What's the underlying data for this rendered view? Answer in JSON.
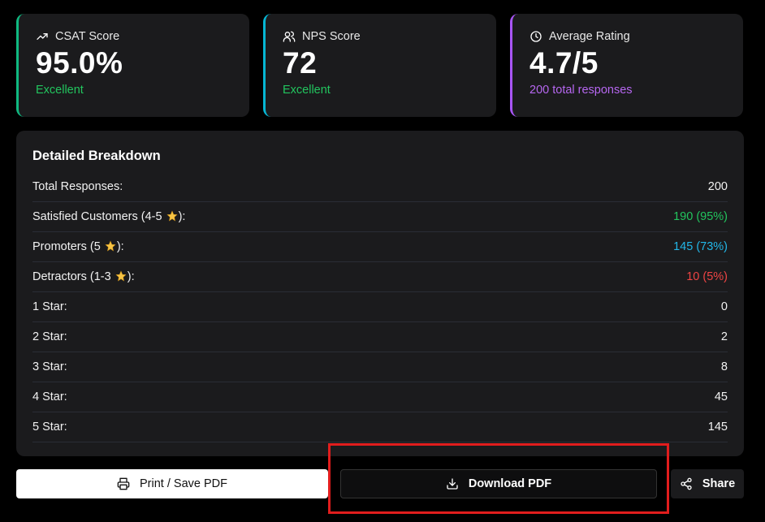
{
  "cards": [
    {
      "label": "CSAT Score",
      "value": "95.0%",
      "sub": "Excellent",
      "icon": "trending-up-icon"
    },
    {
      "label": "NPS Score",
      "value": "72",
      "sub": "Excellent",
      "icon": "users-icon"
    },
    {
      "label": "Average Rating",
      "value": "4.7/5",
      "sub": "200 total responses",
      "icon": "clock-icon"
    }
  ],
  "colors": {
    "csat_accent": "#10b981",
    "nps_accent": "#06b6d4",
    "rating_accent": "#a855f7",
    "positive": "#22c55e",
    "promoter": "#22b7e8",
    "detractor": "#ef4444",
    "highlight": "#e11d1d"
  },
  "breakdown": {
    "title": "Detailed Breakdown",
    "rows": [
      {
        "label": "Total Responses:",
        "value": "200"
      },
      {
        "label_before": "Satisfied Customers (4-5 ",
        "label_after": "):",
        "value": "190 (95%)"
      },
      {
        "label_before": "Promoters (5 ",
        "label_after": "):",
        "value": "145 (73%)"
      },
      {
        "label_before": "Detractors (1-3 ",
        "label_after": "):",
        "value": "10 (5%)"
      },
      {
        "label": "1 Star:",
        "value": "0"
      },
      {
        "label": "2 Star:",
        "value": "2"
      },
      {
        "label": "3 Star:",
        "value": "8"
      },
      {
        "label": "4 Star:",
        "value": "45"
      },
      {
        "label": "5 Star:",
        "value": "145"
      }
    ]
  },
  "actions": {
    "print": "Print / Save PDF",
    "download": "Download PDF",
    "share": "Share"
  }
}
